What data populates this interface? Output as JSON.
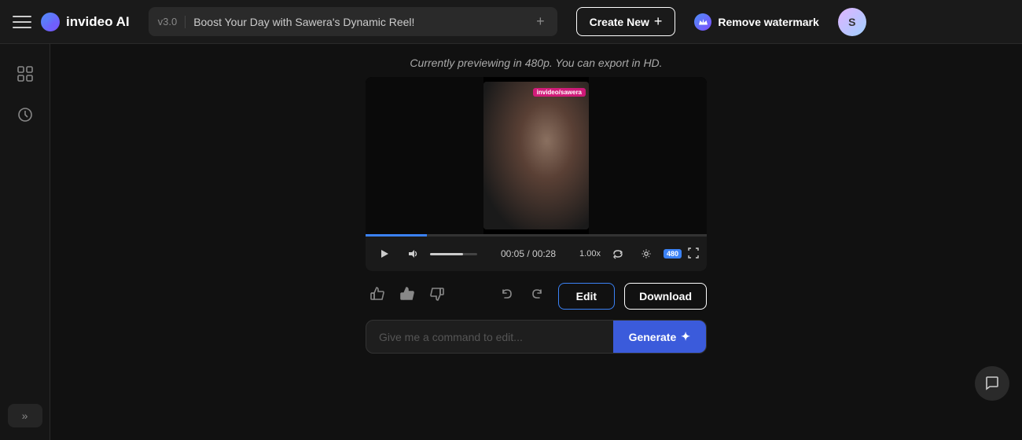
{
  "topbar": {
    "hamburger_label": "Menu",
    "logo_icon": "🔵",
    "logo_text": "invideo AI",
    "version": "v3.0",
    "tab_title": "Boost Your Day with Sawera's Dynamic Reel!",
    "add_tab_label": "+",
    "create_new_label": "Create New",
    "create_plus": "+",
    "watermark_icon": "👑",
    "watermark_label": "Remove watermark",
    "avatar_text": "S"
  },
  "sidebar": {
    "items": [
      {
        "icon": "grid",
        "label": "Grid"
      },
      {
        "icon": "clock",
        "label": "History"
      }
    ],
    "expand_label": "»"
  },
  "preview": {
    "preview_text": "Currently previewing in 480p. You can export in HD.",
    "watermark_text": "invideo/sawera"
  },
  "player": {
    "progress_percent": 18,
    "volume_percent": 70,
    "time_current": "00:05",
    "time_total": "00:28",
    "speed": "1.00x",
    "quality": "480"
  },
  "actions": {
    "thumbs_up_outline": "👍",
    "thumbs_up_fill": "👍",
    "thumbs_down": "👎",
    "undo": "↩",
    "redo": "↪",
    "edit_label": "Edit",
    "download_label": "Download"
  },
  "command": {
    "placeholder": "Give me a command to edit...",
    "generate_label": "Generate",
    "spark": "✦"
  },
  "chat": {
    "icon": "💬"
  }
}
